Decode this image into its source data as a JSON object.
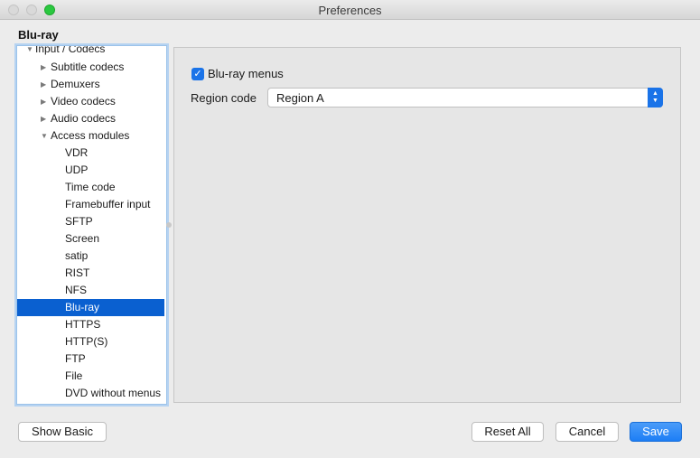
{
  "window": {
    "title": "Preferences"
  },
  "section_title": "Blu-ray",
  "tree": {
    "items": [
      {
        "label": "Input / Codecs",
        "expanded": true
      },
      {
        "label": "Subtitle codecs",
        "expanded": false
      },
      {
        "label": "Demuxers",
        "expanded": false
      },
      {
        "label": "Video codecs",
        "expanded": false
      },
      {
        "label": "Audio codecs",
        "expanded": false
      },
      {
        "label": "Access modules",
        "expanded": true
      },
      {
        "label": "VDR"
      },
      {
        "label": "UDP"
      },
      {
        "label": "Time code"
      },
      {
        "label": "Framebuffer input"
      },
      {
        "label": "SFTP"
      },
      {
        "label": "Screen"
      },
      {
        "label": "satip"
      },
      {
        "label": "RIST"
      },
      {
        "label": "NFS"
      },
      {
        "label": "Blu-ray",
        "selected": true
      },
      {
        "label": "HTTPS"
      },
      {
        "label": "HTTP(S)"
      },
      {
        "label": "FTP"
      },
      {
        "label": "File"
      },
      {
        "label": "DVD without menus"
      }
    ]
  },
  "settings": {
    "menus_label": "Blu-ray menus",
    "menus_checked": true,
    "region_label": "Region code",
    "region_value": "Region A"
  },
  "buttons": {
    "show_basic": "Show Basic",
    "reset_all": "Reset All",
    "cancel": "Cancel",
    "save": "Save"
  },
  "colors": {
    "accent": "#0a60d0",
    "button_primary": "#1d7ef5"
  }
}
